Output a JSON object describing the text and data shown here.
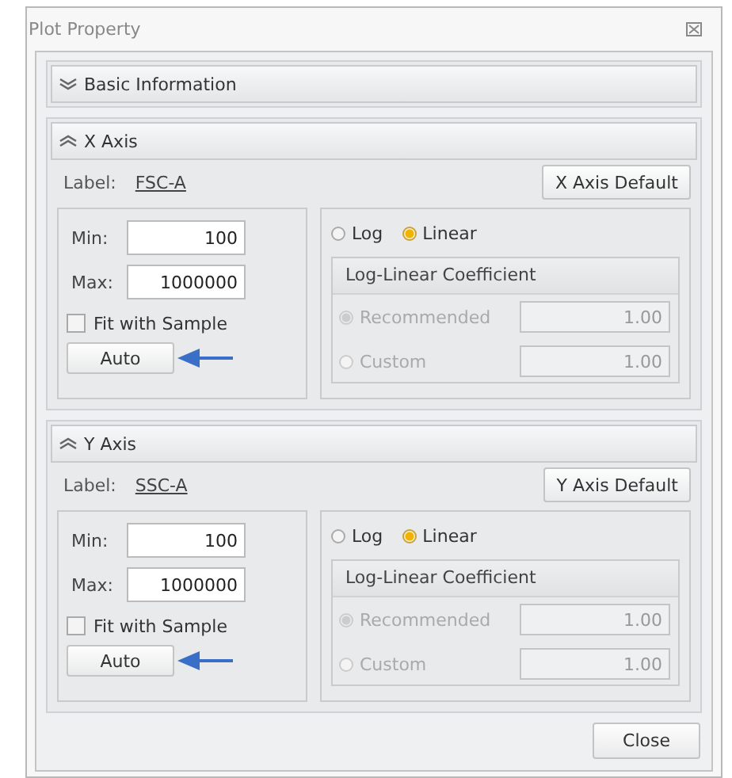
{
  "window": {
    "title": "Plot Property"
  },
  "sections": [
    {
      "title": "Basic Information",
      "expanded": false
    },
    {
      "title": "X Axis",
      "expanded": true,
      "label_caption": "Label:",
      "label_value": "FSC-A",
      "default_button": "X Axis Default",
      "min_label": "Min:",
      "min": "100",
      "max_label": "Max:",
      "max": "1000000",
      "fit_label": "Fit with Sample",
      "fit_checked": false,
      "auto_button": "Auto",
      "scale_options": [
        {
          "label": "Log",
          "selected": false
        },
        {
          "label": "Linear",
          "selected": true
        }
      ],
      "coefficient": {
        "title": "Log-Linear Coefficient",
        "disabled": true,
        "options": [
          {
            "label": "Recommended",
            "selected": true,
            "value": "1.00"
          },
          {
            "label": "Custom",
            "selected": false,
            "value": "1.00"
          }
        ]
      }
    },
    {
      "title": "Y Axis",
      "expanded": true,
      "label_caption": "Label:",
      "label_value": "SSC-A",
      "default_button": "Y Axis Default",
      "min_label": "Min:",
      "min": "100",
      "max_label": "Max:",
      "max": "1000000",
      "fit_label": "Fit with Sample",
      "fit_checked": false,
      "auto_button": "Auto",
      "scale_options": [
        {
          "label": "Log",
          "selected": false
        },
        {
          "label": "Linear",
          "selected": true
        }
      ],
      "coefficient": {
        "title": "Log-Linear Coefficient",
        "disabled": true,
        "options": [
          {
            "label": "Recommended",
            "selected": true,
            "value": "1.00"
          },
          {
            "label": "Custom",
            "selected": false,
            "value": "1.00"
          }
        ]
      }
    }
  ],
  "close_button": "Close"
}
